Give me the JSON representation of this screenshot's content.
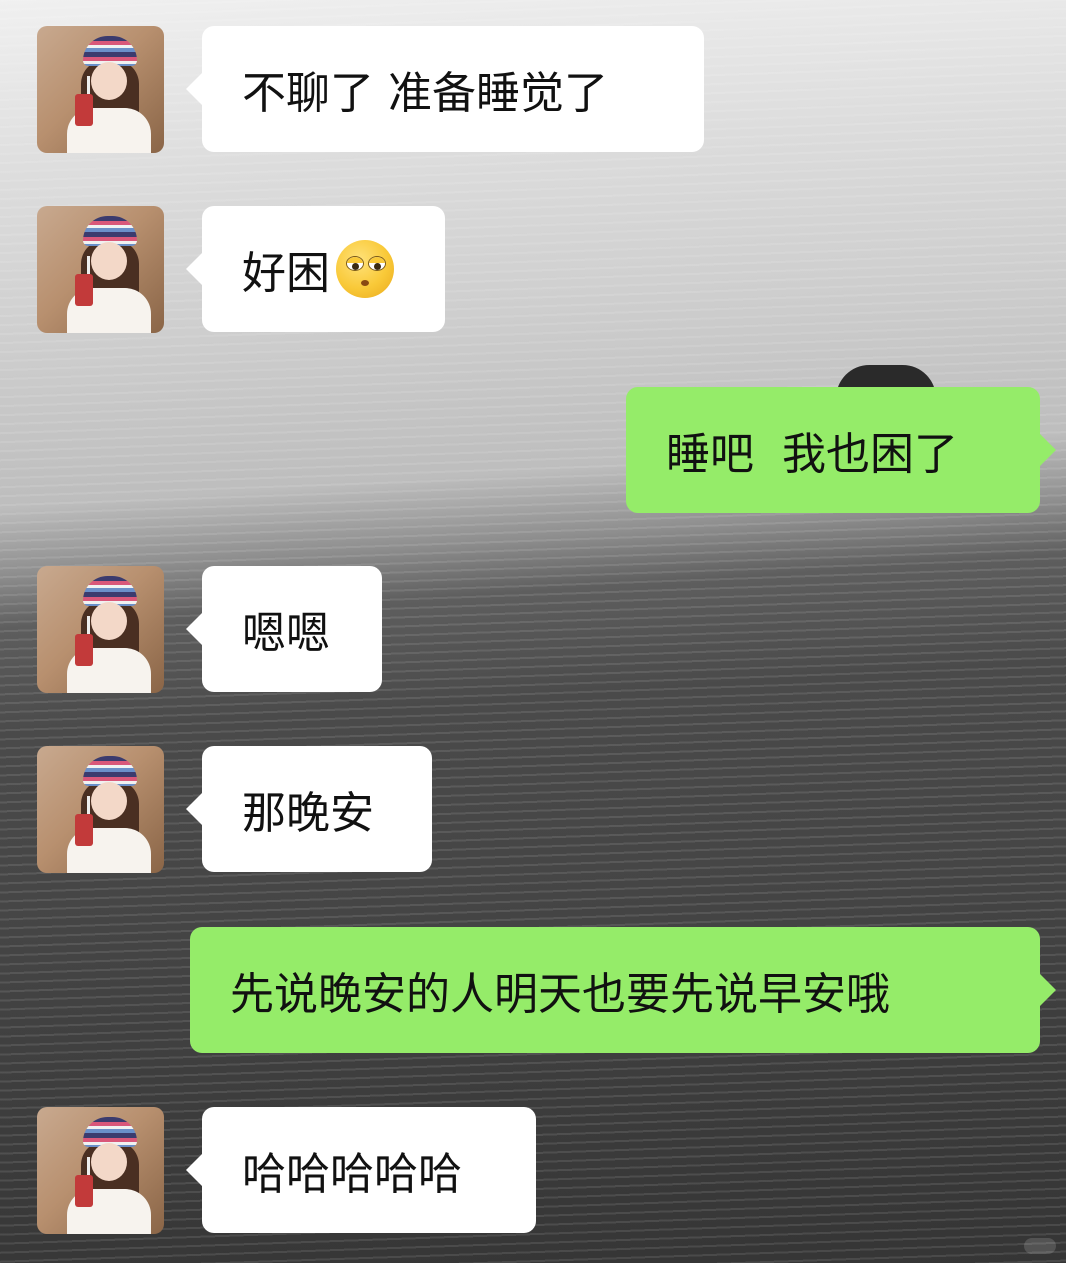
{
  "messages": [
    {
      "side": "in",
      "text": "不聊了 准备睡觉了"
    },
    {
      "side": "in",
      "text": "好困",
      "emoji": "rolling-eyes-emoji"
    },
    {
      "side": "out",
      "text": "睡吧  我也困了"
    },
    {
      "side": "in",
      "text": "嗯嗯"
    },
    {
      "side": "in",
      "text": "那晚安"
    },
    {
      "side": "out",
      "text": "先说晚安的人明天也要先说早安哦"
    },
    {
      "side": "in",
      "text": "哈哈哈哈哈"
    }
  ],
  "colors": {
    "incoming_bubble": "#ffffff",
    "outgoing_bubble": "#95ec69",
    "text": "#111111"
  }
}
